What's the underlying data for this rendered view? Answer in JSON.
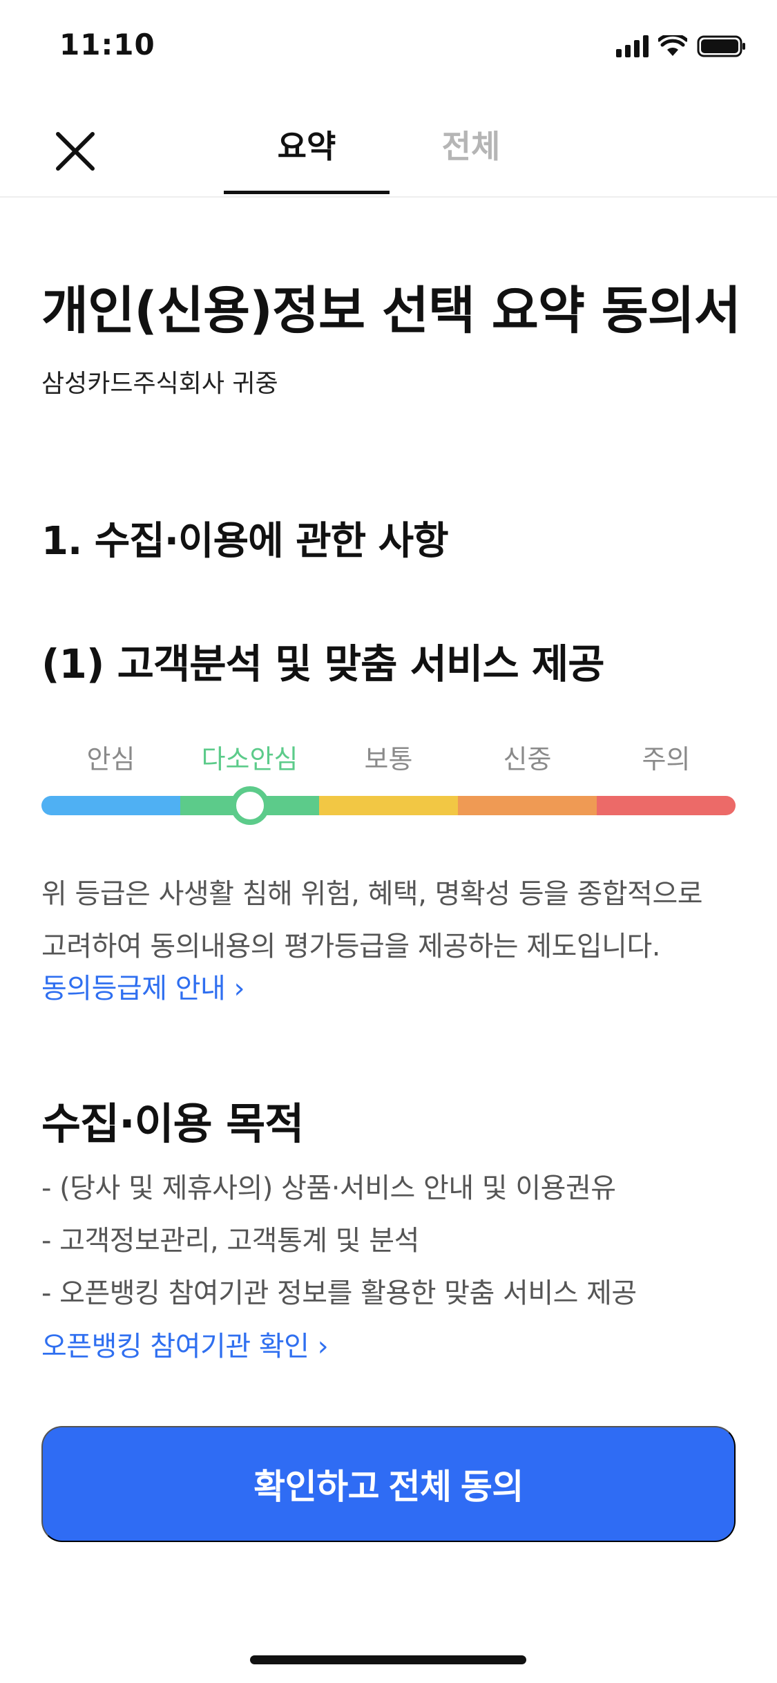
{
  "status_bar": {
    "time": "11:10",
    "icons": [
      "cellular-signal-icon",
      "wifi-icon",
      "battery-icon"
    ]
  },
  "nav": {
    "close_icon": "close-icon",
    "tabs": [
      {
        "label": "요약",
        "selected": true
      },
      {
        "label": "전체",
        "selected": false
      }
    ]
  },
  "document": {
    "title": "개인(신용)정보 선택 요약 동의서",
    "addressee": "삼성카드주식회사 귀중",
    "section_title": "1. 수집·이용에 관한 사항",
    "sub_title": "(1) 고객분석 및 맞춤 서비스 제공"
  },
  "consent_grade": {
    "labels": [
      "안심",
      "다소안심",
      "보통",
      "신중",
      "주의"
    ],
    "selected_index": 1,
    "colors": [
      "#4fb0f3",
      "#5ccb8a",
      "#f2c744",
      "#ef9a54",
      "#ec6a68"
    ],
    "description": "위 등급은 사생활 침해 위험, 혜택, 명확성 등을 종합적으로 고려하여 동의내용의 평가등급을 제공하는 제도입니다.",
    "link_label": "동의등급제 안내 ›"
  },
  "purpose": {
    "title": "수집·이용 목적",
    "items": [
      "- (당사 및 제휴사의) 상품·서비스 안내 및 이용권유",
      "- 고객정보관리, 고객통계 및 분석",
      "- 오픈뱅킹 참여기관 정보를 활용한 맞춤 서비스 제공"
    ],
    "link_label": "오픈뱅킹 참여기관 확인 ›"
  },
  "actions": {
    "confirm_label": "확인하고 전체 동의"
  },
  "colors": {
    "accent": "#2f6cf4",
    "link": "#2f6ff0",
    "selected_grade": "#5ccb8a"
  }
}
